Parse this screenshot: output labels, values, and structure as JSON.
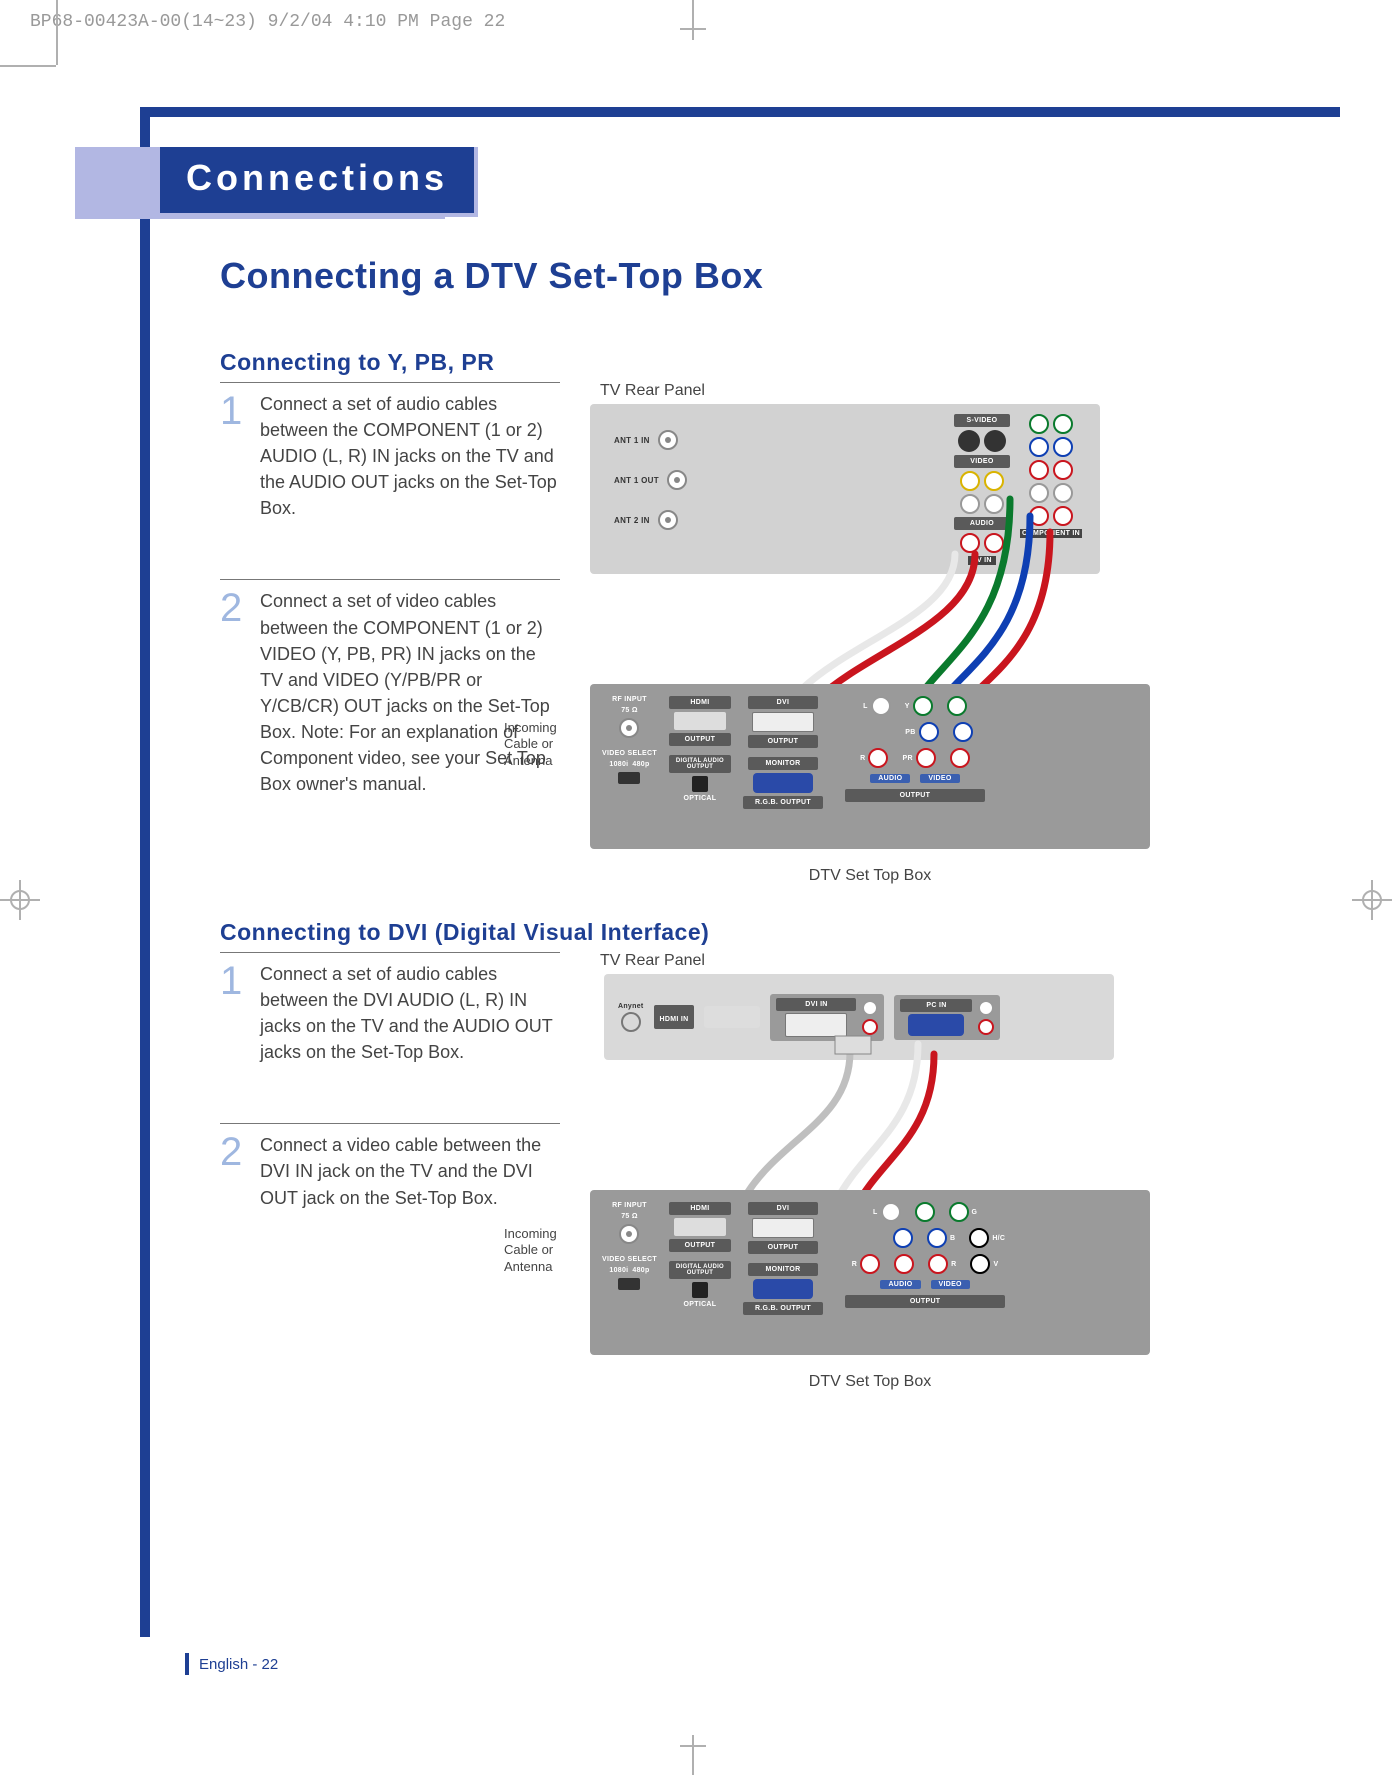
{
  "print_header": "BP68-00423A-00(14~23)  9/2/04  4:10 PM  Page 22",
  "section_title": "Connections",
  "page_title": "Connecting a DTV Set-Top Box",
  "sub1_title": "Connecting to Y, PB, PR",
  "sub1_small_b": "B",
  "sub1_small_r": "R",
  "step1_num": "1",
  "step1_txt": "Connect a set of audio cables between the COMPONENT (1 or 2) AUDIO (L, R) IN jacks on the TV and the AUDIO OUT jacks on the Set-Top Box.",
  "step2_num": "2",
  "step2_txt": "Connect a set of video cables between the COMPONENT (1 or 2) VIDEO (Y, PB, PR) IN jacks on the TV and VIDEO (Y/PB/PR or Y/CB/CR) OUT jacks on the Set-Top Box.\n Note: For an explanation of Component video, see your Set Top Box owner's manual.",
  "sub2_title": "Connecting to DVI (Digital Visual Interface)",
  "step3_num": "1",
  "step3_txt": "Connect a set of audio cables between the DVI AUDIO (L, R) IN jacks on the TV and the AUDIO OUT jacks on the Set-Top Box.",
  "step4_num": "2",
  "step4_txt": "Connect a video cable between the DVI IN jack on the TV and the DVI OUT jack on the Set-Top Box.",
  "label_tv_rear": "TV Rear Panel",
  "label_incoming": "Incoming Cable or Antenna",
  "label_stb": "DTV Set Top Box",
  "ant1": "ANT 1 IN",
  "ant1_out": "ANT 1 OUT",
  "ant2": "ANT 2 IN",
  "lbl_svideo": "S-VIDEO",
  "lbl_video": "VIDEO",
  "lbl_audio": "AUDIO",
  "lbl_avin": "AV IN",
  "lbl_compin": "COMPONENT IN",
  "lbl_hdmi": "HDMI",
  "lbl_dvi": "DVI",
  "lbl_output": "OUTPUT",
  "lbl_monitor": "MONITOR",
  "lbl_optical": "OPTICAL",
  "lbl_rgb": "R.G.B. OUTPUT",
  "lbl_rfin": "RF INPUT",
  "lbl_75": "75 Ω",
  "lbl_vidsel": "VIDEO SELECT",
  "lbl_1080": "1080i",
  "lbl_480": "480p",
  "lbl_digaud": "DIGITAL AUDIO OUTPUT",
  "lbl_dviin": "DVI IN",
  "lbl_pcin": "PC IN",
  "lbl_hdmiin": "HDMI IN",
  "lbl_anynet": "Anynet",
  "lbl_L": "L",
  "lbl_R": "R",
  "lbl_Y": "Y",
  "lbl_Pb": "PB",
  "lbl_Pr": "PR",
  "lbl_G": "G",
  "lbl_B": "B",
  "lbl_Rc": "R",
  "lbl_Hd": "H/C",
  "lbl_V": "V",
  "footer": "English - 22"
}
